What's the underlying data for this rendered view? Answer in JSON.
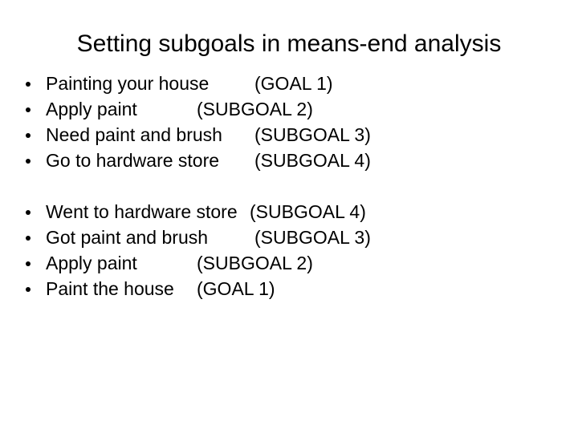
{
  "slide": {
    "title": "Setting subgoals in means-end analysis",
    "background_color": "#ffffff",
    "text_color": "#000000",
    "bullet_glyph": "•",
    "groups": [
      {
        "name": "forward-planning-sequence",
        "items": [
          {
            "label": "Painting your house",
            "tag": "(GOAL 1)",
            "tag_stop": "b"
          },
          {
            "label": "Apply paint",
            "tag": "(SUBGOAL 2)",
            "tag_stop": "a"
          },
          {
            "label": "Need paint and brush",
            "tag": "(SUBGOAL 3)",
            "tag_stop": "b"
          },
          {
            "label": "Go to hardware store",
            "tag": "(SUBGOAL 4)",
            "tag_stop": "b"
          }
        ]
      },
      {
        "name": "execution-sequence",
        "items": [
          {
            "label": "Went to hardware store",
            "tag": "(SUBGOAL 4)",
            "tag_stop": "c"
          },
          {
            "label": "Got paint and brush",
            "tag": "(SUBGOAL 3)",
            "tag_stop": "b"
          },
          {
            "label": "Apply paint",
            "tag": "(SUBGOAL 2)",
            "tag_stop": "a"
          },
          {
            "label": "Paint the house",
            "tag": "(GOAL 1)",
            "tag_stop": "a"
          }
        ]
      }
    ]
  }
}
